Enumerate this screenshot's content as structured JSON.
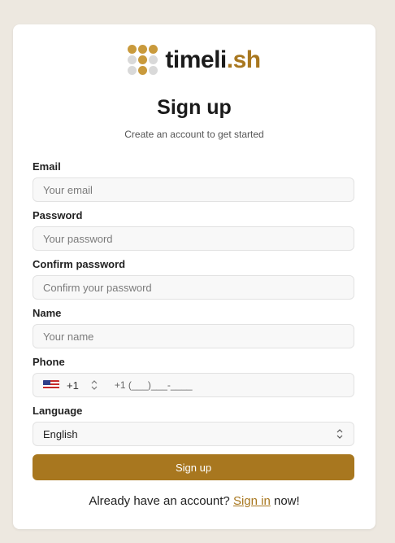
{
  "brand": {
    "name_main": "timeli",
    "name_accent": ".sh",
    "logo_icon": "dot-grid-logo",
    "colors": {
      "accent": "#a8771f",
      "dot_gold": "#c99a3c",
      "dot_gray": "#d9d9d9"
    }
  },
  "page": {
    "title": "Sign up",
    "subtitle": "Create an account to get started"
  },
  "form": {
    "email": {
      "label": "Email",
      "placeholder": "Your email",
      "value": ""
    },
    "password": {
      "label": "Password",
      "placeholder": "Your password",
      "value": ""
    },
    "confirm_password": {
      "label": "Confirm password",
      "placeholder": "Confirm your password",
      "value": ""
    },
    "name": {
      "label": "Name",
      "placeholder": "Your name",
      "value": ""
    },
    "phone": {
      "label": "Phone",
      "country_flag": "us-flag-icon",
      "dial_code": "+1",
      "placeholder": "+1 (___)___-____",
      "value": ""
    },
    "language": {
      "label": "Language",
      "selected": "English"
    },
    "submit_label": "Sign up"
  },
  "footer": {
    "prefix": "Already have an account? ",
    "link_label": "Sign in",
    "suffix": " now!"
  }
}
